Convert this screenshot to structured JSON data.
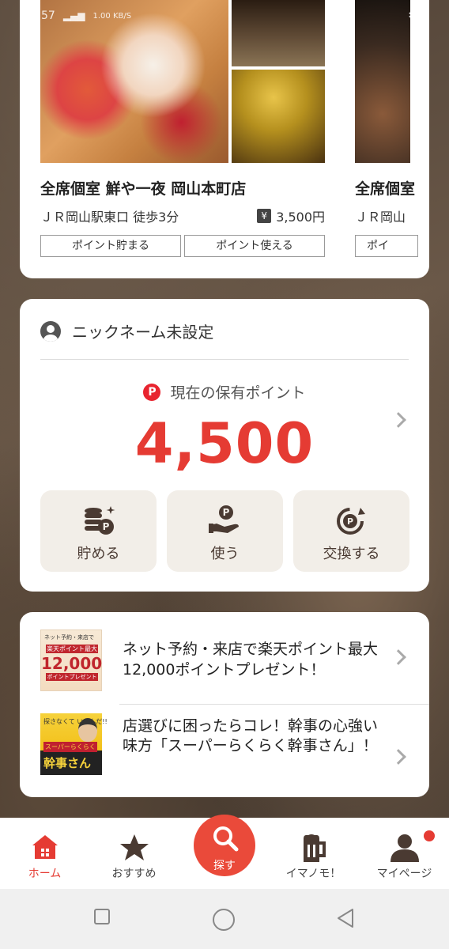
{
  "status_bar": {
    "time": "57",
    "net_speed": "1.00 KB/S"
  },
  "featured": {
    "name": "全席個室 鮮や一夜 岡山本町店",
    "access": "ＪＲ岡山駅東口 徒歩3分",
    "price": "3,500円",
    "tag_earn": "ポイント貯まる",
    "tag_use": "ポイント使える"
  },
  "featured2": {
    "name": "全席個室",
    "access": "ＪＲ岡山",
    "tag": "ポイ"
  },
  "points": {
    "nickname": "ニックネーム未設定",
    "label": "現在の保有ポイント",
    "p_mark": "P",
    "value": "4,500",
    "actions": [
      {
        "label": "貯める",
        "icon": "coins-icon"
      },
      {
        "label": "使う",
        "icon": "hand-point-icon"
      },
      {
        "label": "交換する",
        "icon": "exchange-icon"
      }
    ]
  },
  "promos": [
    {
      "text": "ネット予約・来店で楽天ポイント最大12,000ポイントプレゼント！",
      "thumb_small": "ネット予約・来店で",
      "thumb_red": "楽天ポイント最大",
      "thumb_num": "12,000",
      "thumb_foot": "ポイントプレゼント"
    },
    {
      "text": "店選びに困ったらコレ！幹事の心強い味方「スーパーらくらく幹事さん」！",
      "thumb_top": "探さなくて いいんだ!!",
      "thumb_mid": "スーパーらくらく",
      "thumb_big": "幹事さん"
    }
  ],
  "nav": {
    "home": "ホーム",
    "recommend": "おすすめ",
    "search": "探す",
    "imanomo": "イマノモ！",
    "mypage": "マイページ"
  },
  "colors": {
    "accent": "#e53b33",
    "action_bg": "#f2eee8",
    "action_fg": "#4a3a32"
  }
}
